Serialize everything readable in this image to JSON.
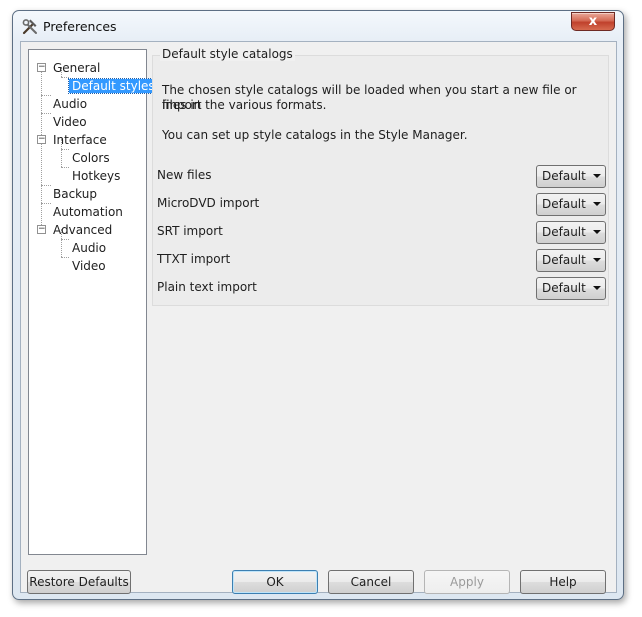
{
  "window": {
    "title": "Preferences",
    "close_glyph": "x"
  },
  "sidebar": {
    "items": [
      {
        "label": "General",
        "level": 0,
        "expanded": true
      },
      {
        "label": "Default styles",
        "level": 1,
        "selected": true
      },
      {
        "label": "Audio",
        "level": 0
      },
      {
        "label": "Video",
        "level": 0
      },
      {
        "label": "Interface",
        "level": 0,
        "expanded": true
      },
      {
        "label": "Colors",
        "level": 1
      },
      {
        "label": "Hotkeys",
        "level": 1
      },
      {
        "label": "Backup",
        "level": 0
      },
      {
        "label": "Automation",
        "level": 0
      },
      {
        "label": "Advanced",
        "level": 0,
        "expanded": true
      },
      {
        "label": "Audio",
        "level": 1
      },
      {
        "label": "Video",
        "level": 1
      }
    ]
  },
  "group": {
    "title": "Default style catalogs",
    "description_line1": "The chosen style catalogs will be loaded when you start a new file or import",
    "description_line2": "files in the various formats.",
    "description_line3": "You can set up style catalogs in the Style Manager.",
    "rows": [
      {
        "label": "New files",
        "value": "Default"
      },
      {
        "label": "MicroDVD import",
        "value": "Default"
      },
      {
        "label": "SRT import",
        "value": "Default"
      },
      {
        "label": "TTXT import",
        "value": "Default"
      },
      {
        "label": "Plain text import",
        "value": "Default"
      }
    ]
  },
  "buttons": {
    "restore_defaults": "Restore Defaults",
    "ok": "OK",
    "cancel": "Cancel",
    "apply": "Apply",
    "help": "Help"
  },
  "icons": {
    "app": "hammer-wrench-icon",
    "expander": "minus-icon"
  }
}
